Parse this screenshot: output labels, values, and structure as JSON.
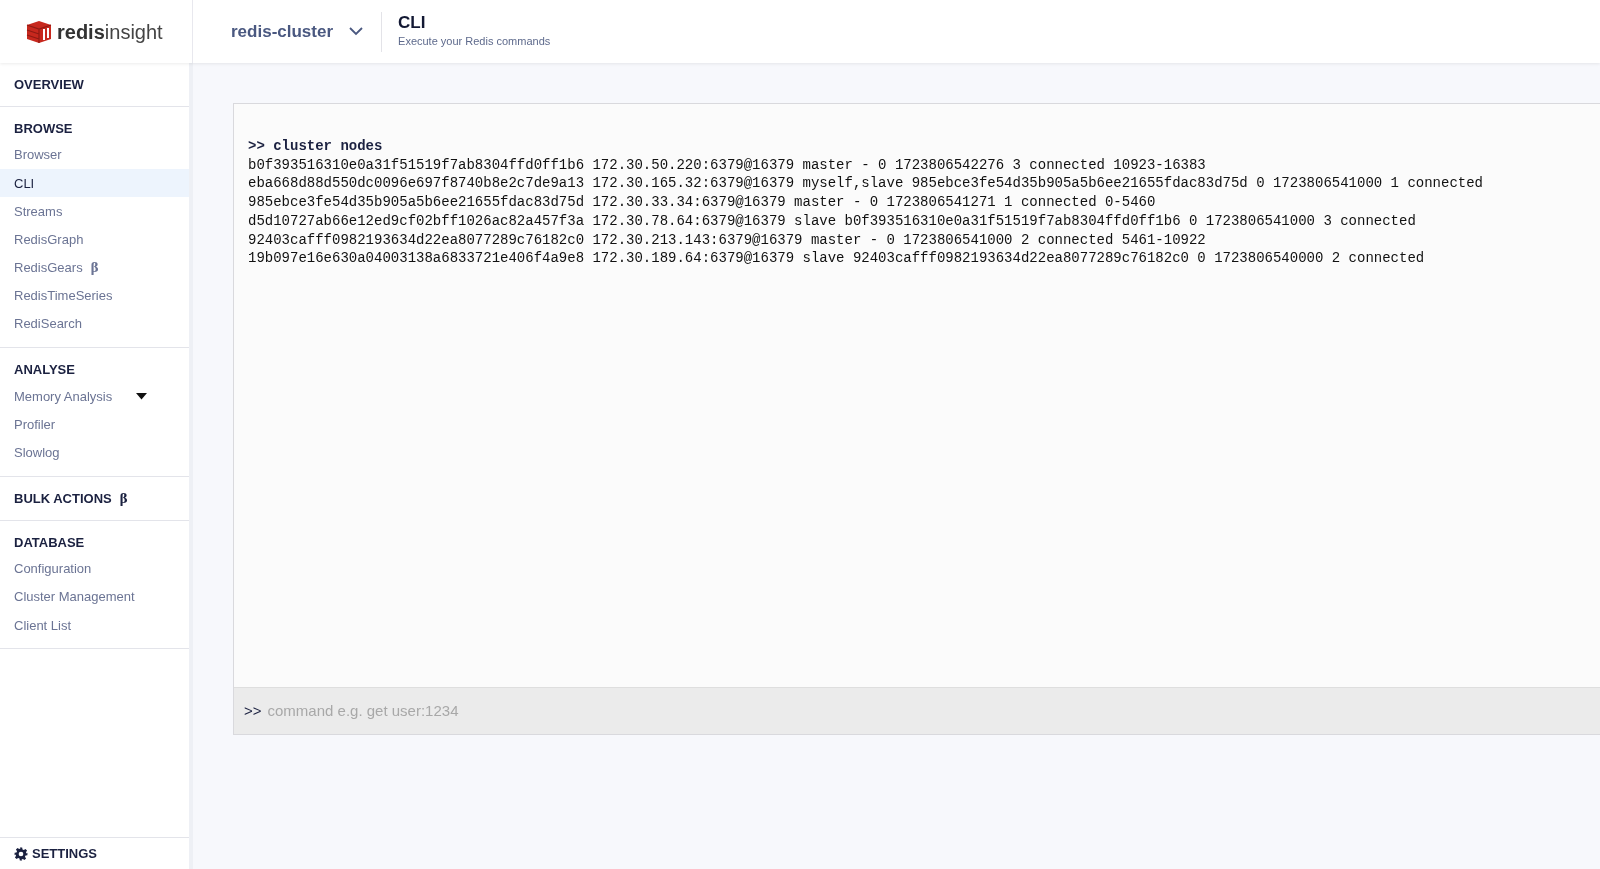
{
  "header": {
    "logo_text": "**redis**insight",
    "database_selector": {
      "label": "redis-cluster"
    },
    "page": {
      "title": "CLI",
      "subtitle": "Execute your Redis commands"
    }
  },
  "sidebar": {
    "sections": [
      {
        "heading": "OVERVIEW"
      },
      {
        "heading": "BROWSE",
        "items": [
          {
            "label": "Browser",
            "selected": false,
            "kind": "link"
          },
          {
            "label": "CLI",
            "selected": true,
            "kind": "link"
          },
          {
            "label": "Streams",
            "selected": false,
            "kind": "link"
          },
          {
            "label": "RedisGraph",
            "selected": false,
            "kind": "link"
          },
          {
            "label": "RedisGears",
            "badge": "β",
            "selected": false,
            "kind": "link"
          },
          {
            "label": "RedisTimeSeries",
            "selected": false,
            "kind": "link"
          },
          {
            "label": "RediSearch",
            "selected": false,
            "kind": "link"
          }
        ]
      },
      {
        "heading": "ANALYSE",
        "items": [
          {
            "label": "Memory Analysis",
            "selected": false,
            "kind": "dropdown"
          },
          {
            "label": "Profiler",
            "selected": false,
            "kind": "link"
          },
          {
            "label": "Slowlog",
            "selected": false,
            "kind": "link"
          }
        ]
      },
      {
        "heading": "BULK ACTIONS",
        "badge": "β"
      },
      {
        "heading": "DATABASE",
        "items": [
          {
            "label": "Configuration",
            "selected": false,
            "kind": "link"
          },
          {
            "label": "Cluster Management",
            "selected": false,
            "kind": "link"
          },
          {
            "label": "Client List",
            "selected": false,
            "kind": "link"
          }
        ]
      }
    ],
    "settings": {
      "label": "SETTINGS"
    }
  },
  "cli": {
    "output": [
      {
        "kind": "command",
        "prompt": ">>",
        "text": "cluster nodes"
      },
      {
        "kind": "result",
        "text": "b0f393516310e0a31f51519f7ab8304ffd0ff1b6 172.30.50.220:6379@16379 master - 0 1723806542276 3 connected 10923-16383"
      },
      {
        "kind": "result",
        "text": "eba668d88d550dc0096e697f8740b8e2c7de9a13 172.30.165.32:6379@16379 myself,slave 985ebce3fe54d35b905a5b6ee21655fdac83d75d 0 1723806541000 1 connected"
      },
      {
        "kind": "result",
        "text": "985ebce3fe54d35b905a5b6ee21655fdac83d75d 172.30.33.34:6379@16379 master - 0 1723806541271 1 connected 0-5460"
      },
      {
        "kind": "result",
        "text": "d5d10727ab66e12ed9cf02bff1026ac82a457f3a 172.30.78.64:6379@16379 slave b0f393516310e0a31f51519f7ab8304ffd0ff1b6 0 1723806541000 3 connected"
      },
      {
        "kind": "result",
        "text": "92403cafff0982193634d22ea8077289c76182c0 172.30.213.143:6379@16379 master - 0 1723806541000 2 connected 5461-10922"
      },
      {
        "kind": "result",
        "text": "19b097e16e630a04003138a6833721e406f4a9e8 172.30.189.64:6379@16379 slave 92403cafff0982193634d22ea8077289c76182c0 0 1723806540000 2 connected"
      }
    ],
    "input": {
      "prompt": ">>",
      "placeholder": "command e.g. get user:1234"
    }
  }
}
